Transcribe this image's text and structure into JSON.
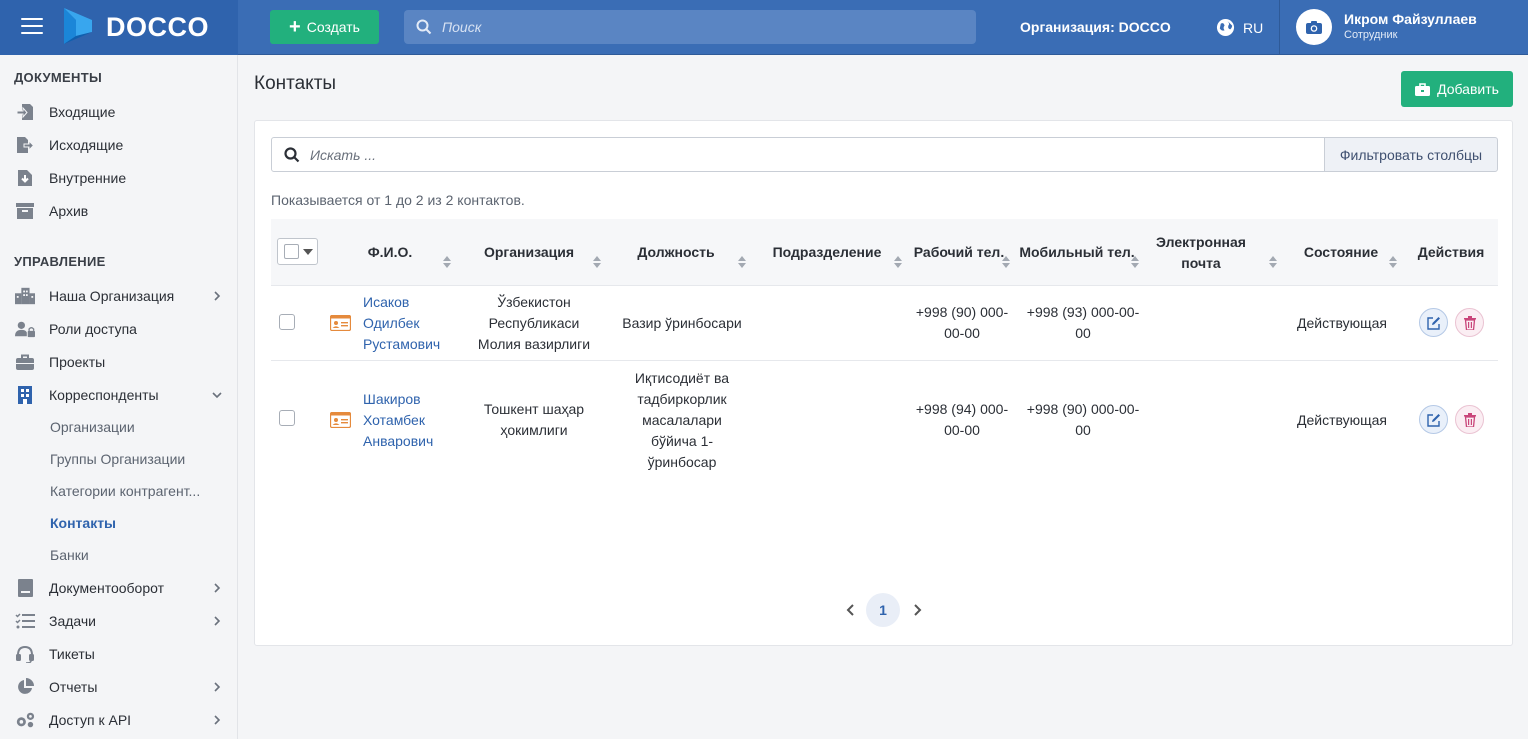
{
  "header": {
    "logo_text": "DOCCO",
    "create_label": "Создать",
    "search_placeholder": "Поиск",
    "organization": "Организация: DOCCO",
    "language": "RU",
    "user_name": "Икром Файзуллаев",
    "user_role": "Сотрудник"
  },
  "sidebar": {
    "documents_title": "ДОКУМЕНТЫ",
    "documents": [
      {
        "label": "Входящие",
        "icon": "inbox-icon"
      },
      {
        "label": "Исходящие",
        "icon": "outbox-icon"
      },
      {
        "label": "Внутренние",
        "icon": "internal-doc-icon"
      },
      {
        "label": "Архив",
        "icon": "archive-icon"
      }
    ],
    "management_title": "УПРАВЛЕНИЕ",
    "management": [
      {
        "label": "Наша Организация",
        "icon": "building-icon",
        "chevron": "right"
      },
      {
        "label": "Роли доступа",
        "icon": "users-lock-icon"
      },
      {
        "label": "Проекты",
        "icon": "briefcase-icon"
      },
      {
        "label": "Корреспонденты",
        "icon": "office-building-icon",
        "chevron": "down"
      }
    ],
    "sub_items": [
      "Организации",
      "Группы Организации",
      "Категории контрагент...",
      "Контакты",
      "Банки"
    ],
    "active_sub": "Контакты",
    "bottom": [
      {
        "label": "Документооборот",
        "icon": "doc-flow-icon",
        "chevron": "right"
      },
      {
        "label": "Задачи",
        "icon": "tasks-icon",
        "chevron": "right"
      },
      {
        "label": "Тикеты",
        "icon": "headset-icon"
      },
      {
        "label": "Отчеты",
        "icon": "pie-chart-icon",
        "chevron": "right"
      },
      {
        "label": "Доступ к API",
        "icon": "gears-icon",
        "chevron": "right"
      }
    ]
  },
  "main": {
    "title": "Контакты",
    "add_label": "Добавить",
    "search_placeholder": "Искать ...",
    "filter_label": "Фильтровать столбцы",
    "showing_text": "Показывается от 1 до 2 из 2 контактов.",
    "columns": {
      "fio": "Ф.И.О.",
      "org": "Организация",
      "position": "Должность",
      "department": "Подразделение",
      "work_phone": "Рабочий тел.",
      "mobile_phone": "Мобильный тел.",
      "email": "Электронная почта",
      "status": "Состояние",
      "actions": "Действия"
    },
    "rows": [
      {
        "name": "Исаков Одилбек Рустамович",
        "org": "Ўзбекистон Республикаси Молия вазирлиги",
        "position": "Вазир ўринбосари",
        "department": "",
        "work_phone": "+998 (90) 000-00-00",
        "mobile_phone": "+998 (93) 000-00-00",
        "email": "",
        "status": "Действующая"
      },
      {
        "name": "Шакиров Хотамбек Анварович",
        "org": "Тошкент шаҳар ҳокимлиги",
        "position": "Иқтисодиёт ва тадбиркорлик масалалари бўйича 1-ўринбосар",
        "department": "",
        "work_phone": "+998 (94) 000-00-00",
        "mobile_phone": "+998 (90) 000-00-00",
        "email": "",
        "status": "Действующая"
      }
    ],
    "pagination": {
      "current": "1"
    }
  },
  "colors": {
    "topbar": "#3a6db5",
    "brand": "#2f63ad",
    "accent_green": "#22b07d",
    "link": "#2f63ad",
    "contact_icon": "#e58a3c"
  }
}
